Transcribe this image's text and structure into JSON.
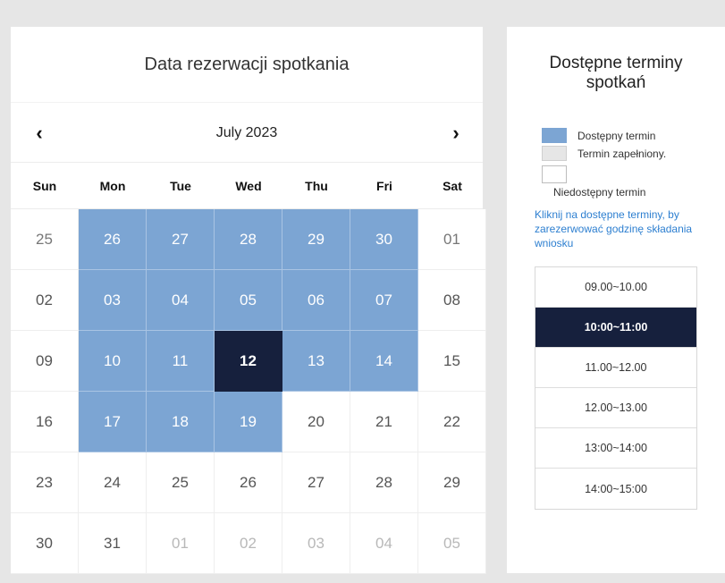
{
  "calendar": {
    "title": "Data rezerwacji spotkania",
    "month_label": "July 2023",
    "prev_icon": "‹",
    "next_icon": "›",
    "weekdays": [
      "Sun",
      "Mon",
      "Tue",
      "Wed",
      "Thu",
      "Fri",
      "Sat"
    ],
    "days": [
      {
        "label": "25",
        "state": "muted"
      },
      {
        "label": "26",
        "state": "available"
      },
      {
        "label": "27",
        "state": "available"
      },
      {
        "label": "28",
        "state": "available"
      },
      {
        "label": "29",
        "state": "available"
      },
      {
        "label": "30",
        "state": "available"
      },
      {
        "label": "01",
        "state": "muted"
      },
      {
        "label": "02",
        "state": "normal"
      },
      {
        "label": "03",
        "state": "available"
      },
      {
        "label": "04",
        "state": "available"
      },
      {
        "label": "05",
        "state": "available"
      },
      {
        "label": "06",
        "state": "available"
      },
      {
        "label": "07",
        "state": "available"
      },
      {
        "label": "08",
        "state": "normal"
      },
      {
        "label": "09",
        "state": "normal"
      },
      {
        "label": "10",
        "state": "available"
      },
      {
        "label": "11",
        "state": "available"
      },
      {
        "label": "12",
        "state": "selected"
      },
      {
        "label": "13",
        "state": "available"
      },
      {
        "label": "14",
        "state": "available"
      },
      {
        "label": "15",
        "state": "normal"
      },
      {
        "label": "16",
        "state": "normal"
      },
      {
        "label": "17",
        "state": "available"
      },
      {
        "label": "18",
        "state": "available"
      },
      {
        "label": "19",
        "state": "available"
      },
      {
        "label": "20",
        "state": "normal"
      },
      {
        "label": "21",
        "state": "normal"
      },
      {
        "label": "22",
        "state": "normal"
      },
      {
        "label": "23",
        "state": "normal"
      },
      {
        "label": "24",
        "state": "normal"
      },
      {
        "label": "25",
        "state": "normal"
      },
      {
        "label": "26",
        "state": "normal"
      },
      {
        "label": "27",
        "state": "normal"
      },
      {
        "label": "28",
        "state": "normal"
      },
      {
        "label": "29",
        "state": "normal"
      },
      {
        "label": "30",
        "state": "normal"
      },
      {
        "label": "31",
        "state": "normal"
      },
      {
        "label": "01",
        "state": "faded"
      },
      {
        "label": "02",
        "state": "faded"
      },
      {
        "label": "03",
        "state": "faded"
      },
      {
        "label": "04",
        "state": "faded"
      },
      {
        "label": "05",
        "state": "faded"
      }
    ]
  },
  "sidebar": {
    "title_line1": "Dostępne terminy",
    "title_line2": "spotkań",
    "legend": {
      "available": "Dostępny termin",
      "full": "Termin zapełniony.",
      "unavailable": "Niedostępny termin"
    },
    "hint": "Kliknij na dostępne terminy, by zarezerwować godzinę składania wniosku",
    "slots": [
      {
        "label": "09.00~10.00",
        "selected": false
      },
      {
        "label": "10:00~11:00",
        "selected": true
      },
      {
        "label": "11.00~12.00",
        "selected": false
      },
      {
        "label": "12.00~13.00",
        "selected": false
      },
      {
        "label": "13:00~14:00",
        "selected": false
      },
      {
        "label": "14:00~15:00",
        "selected": false
      }
    ]
  },
  "colors": {
    "available": "#7ca5d3",
    "selected": "#16203d",
    "full": "#e6e6e6",
    "hint": "#2d7fd0"
  }
}
